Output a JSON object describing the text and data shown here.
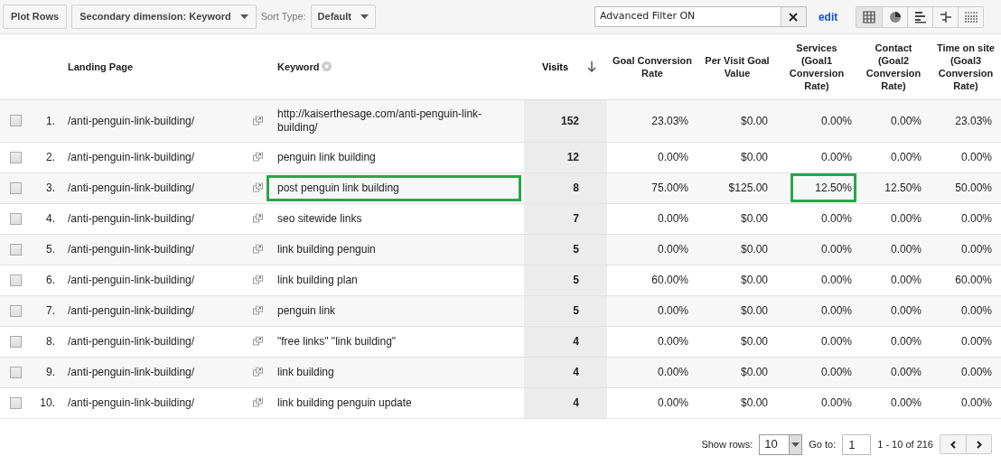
{
  "toolbar": {
    "plot_button": "Plot Rows",
    "secondary_dimension": "Secondary dimension: Keyword",
    "sort_label": "Sort Type:",
    "sort_value": "Default",
    "filter_value": "Advanced Filter ON",
    "edit_link": "edit",
    "views": [
      {
        "kind": "table",
        "selected": true
      },
      {
        "kind": "pie",
        "selected": false
      },
      {
        "kind": "bar",
        "selected": false
      },
      {
        "kind": "comparison",
        "selected": false
      },
      {
        "kind": "pivot",
        "selected": false
      }
    ]
  },
  "columns": [
    {
      "label": "Landing Page",
      "removable": false,
      "sorted": false
    },
    {
      "label": "Keyword",
      "removable": true,
      "sorted": false
    },
    {
      "label": "Visits",
      "removable": false,
      "sorted": true
    },
    {
      "label": "Goal Conversion Rate",
      "removable": false,
      "sorted": false
    },
    {
      "label": "Per Visit Goal Value",
      "removable": false,
      "sorted": false
    },
    {
      "label": "Services (Goal1 Conversion Rate)",
      "removable": false,
      "sorted": false
    },
    {
      "label": "Contact (Goal2 Conversion Rate)",
      "removable": false,
      "sorted": false
    },
    {
      "label": "Time on site (Goal3 Conversion Rate)",
      "removable": false,
      "sorted": false
    }
  ],
  "rows": [
    {
      "number": "1.",
      "checked": false,
      "cells": [
        {
          "text": "/anti-penguin-link-building/",
          "highlighted": false
        },
        {
          "text": "http://kaiserthesage.com/anti-penguin-link-building/",
          "highlighted": false
        },
        {
          "text": "152",
          "highlighted": false
        },
        {
          "text": "23.03%",
          "highlighted": false
        },
        {
          "text": "$0.00",
          "highlighted": false
        },
        {
          "text": "0.00%",
          "highlighted": false
        },
        {
          "text": "0.00%",
          "highlighted": false
        },
        {
          "text": "23.03%",
          "highlighted": false
        }
      ]
    },
    {
      "number": "2.",
      "checked": false,
      "cells": [
        {
          "text": "/anti-penguin-link-building/",
          "highlighted": false
        },
        {
          "text": "penguin link building",
          "highlighted": false
        },
        {
          "text": "12",
          "highlighted": false
        },
        {
          "text": "0.00%",
          "highlighted": false
        },
        {
          "text": "$0.00",
          "highlighted": false
        },
        {
          "text": "0.00%",
          "highlighted": false
        },
        {
          "text": "0.00%",
          "highlighted": false
        },
        {
          "text": "0.00%",
          "highlighted": false
        }
      ]
    },
    {
      "number": "3.",
      "checked": false,
      "cells": [
        {
          "text": "/anti-penguin-link-building/",
          "highlighted": false
        },
        {
          "text": "post penguin link building",
          "highlighted": true
        },
        {
          "text": "8",
          "highlighted": false
        },
        {
          "text": "75.00%",
          "highlighted": false
        },
        {
          "text": "$125.00",
          "highlighted": false
        },
        {
          "text": "12.50%",
          "highlighted": true
        },
        {
          "text": "12.50%",
          "highlighted": false
        },
        {
          "text": "50.00%",
          "highlighted": false
        }
      ]
    },
    {
      "number": "4.",
      "checked": false,
      "cells": [
        {
          "text": "/anti-penguin-link-building/",
          "highlighted": false
        },
        {
          "text": "seo sitewide links",
          "highlighted": false
        },
        {
          "text": "7",
          "highlighted": false
        },
        {
          "text": "0.00%",
          "highlighted": false
        },
        {
          "text": "$0.00",
          "highlighted": false
        },
        {
          "text": "0.00%",
          "highlighted": false
        },
        {
          "text": "0.00%",
          "highlighted": false
        },
        {
          "text": "0.00%",
          "highlighted": false
        }
      ]
    },
    {
      "number": "5.",
      "checked": false,
      "cells": [
        {
          "text": "/anti-penguin-link-building/",
          "highlighted": false
        },
        {
          "text": "link building penguin",
          "highlighted": false
        },
        {
          "text": "5",
          "highlighted": false
        },
        {
          "text": "0.00%",
          "highlighted": false
        },
        {
          "text": "$0.00",
          "highlighted": false
        },
        {
          "text": "0.00%",
          "highlighted": false
        },
        {
          "text": "0.00%",
          "highlighted": false
        },
        {
          "text": "0.00%",
          "highlighted": false
        }
      ]
    },
    {
      "number": "6.",
      "checked": false,
      "cells": [
        {
          "text": "/anti-penguin-link-building/",
          "highlighted": false
        },
        {
          "text": "link building plan",
          "highlighted": false
        },
        {
          "text": "5",
          "highlighted": false
        },
        {
          "text": "60.00%",
          "highlighted": false
        },
        {
          "text": "$0.00",
          "highlighted": false
        },
        {
          "text": "0.00%",
          "highlighted": false
        },
        {
          "text": "0.00%",
          "highlighted": false
        },
        {
          "text": "60.00%",
          "highlighted": false
        }
      ]
    },
    {
      "number": "7.",
      "checked": false,
      "cells": [
        {
          "text": "/anti-penguin-link-building/",
          "highlighted": false
        },
        {
          "text": "penguin link",
          "highlighted": false
        },
        {
          "text": "5",
          "highlighted": false
        },
        {
          "text": "0.00%",
          "highlighted": false
        },
        {
          "text": "$0.00",
          "highlighted": false
        },
        {
          "text": "0.00%",
          "highlighted": false
        },
        {
          "text": "0.00%",
          "highlighted": false
        },
        {
          "text": "0.00%",
          "highlighted": false
        }
      ]
    },
    {
      "number": "8.",
      "checked": false,
      "cells": [
        {
          "text": "/anti-penguin-link-building/",
          "highlighted": false
        },
        {
          "text": "\"free links\" \"link building\"",
          "highlighted": false
        },
        {
          "text": "4",
          "highlighted": false
        },
        {
          "text": "0.00%",
          "highlighted": false
        },
        {
          "text": "$0.00",
          "highlighted": false
        },
        {
          "text": "0.00%",
          "highlighted": false
        },
        {
          "text": "0.00%",
          "highlighted": false
        },
        {
          "text": "0.00%",
          "highlighted": false
        }
      ]
    },
    {
      "number": "9.",
      "checked": false,
      "cells": [
        {
          "text": "/anti-penguin-link-building/",
          "highlighted": false
        },
        {
          "text": "link building",
          "highlighted": false
        },
        {
          "text": "4",
          "highlighted": false
        },
        {
          "text": "0.00%",
          "highlighted": false
        },
        {
          "text": "$0.00",
          "highlighted": false
        },
        {
          "text": "0.00%",
          "highlighted": false
        },
        {
          "text": "0.00%",
          "highlighted": false
        },
        {
          "text": "0.00%",
          "highlighted": false
        }
      ]
    },
    {
      "number": "10.",
      "checked": false,
      "cells": [
        {
          "text": "/anti-penguin-link-building/",
          "highlighted": false
        },
        {
          "text": "link building penguin update",
          "highlighted": false
        },
        {
          "text": "4",
          "highlighted": false
        },
        {
          "text": "0.00%",
          "highlighted": false
        },
        {
          "text": "$0.00",
          "highlighted": false
        },
        {
          "text": "0.00%",
          "highlighted": false
        },
        {
          "text": "0.00%",
          "highlighted": false
        },
        {
          "text": "0.00%",
          "highlighted": false
        }
      ]
    }
  ],
  "pagination": {
    "show_rows_label": "Show rows:",
    "show_rows_value": "10",
    "goto_label": "Go to:",
    "goto_value": "1",
    "range": "1 - 10 of 216"
  }
}
